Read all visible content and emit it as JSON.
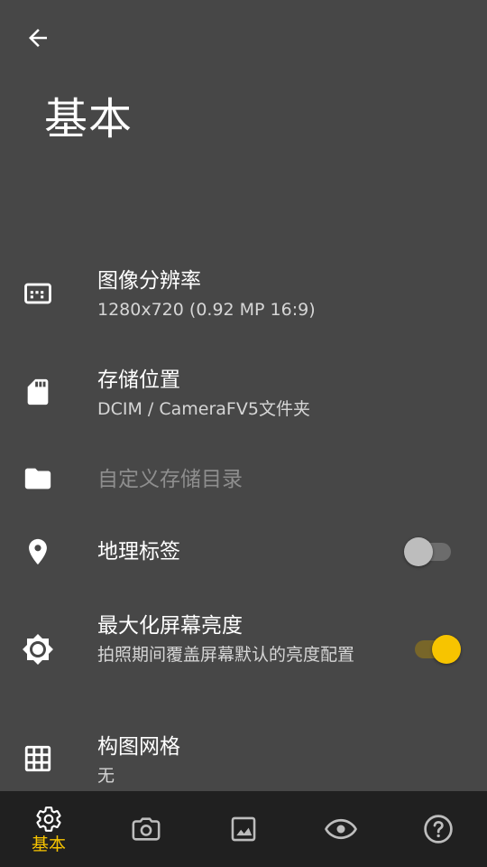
{
  "header": {
    "title": "基本"
  },
  "settings": [
    {
      "title": "图像分辨率",
      "subtitle": "1280x720 (0.92 MP 16:9)",
      "icon": "aspect-ratio-icon"
    },
    {
      "title": "存储位置",
      "subtitle": "DCIM / CameraFV5文件夹",
      "icon": "sd-card-icon"
    },
    {
      "title": "自定义存储目录",
      "subtitle": "",
      "icon": "folder-icon",
      "enabled": false
    },
    {
      "title": "地理标签",
      "subtitle": "",
      "icon": "location-pin-icon",
      "toggle": false
    },
    {
      "title": "最大化屏幕亮度",
      "subtitle": "拍照期间覆盖屏幕默认的亮度配置",
      "icon": "brightness-icon",
      "toggle": true
    },
    {
      "title": "构图网格",
      "subtitle": "无",
      "icon": "grid-icon"
    }
  ],
  "bottom_nav": [
    {
      "label": "基本",
      "icon": "gear-icon",
      "active": true
    },
    {
      "label": "",
      "icon": "camera-icon",
      "active": false
    },
    {
      "label": "",
      "icon": "image-icon",
      "active": false
    },
    {
      "label": "",
      "icon": "eye-icon",
      "active": false
    },
    {
      "label": "",
      "icon": "help-icon",
      "active": false
    }
  ],
  "colors": {
    "background": "#474747",
    "bottom_nav_background": "#202020",
    "accent": "#f7c400",
    "toggle_off_thumb": "#bdbdbd",
    "toggle_off_track": "#6c6c6c",
    "toggle_on_track": "#786629"
  }
}
